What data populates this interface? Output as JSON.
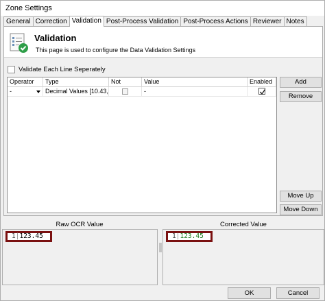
{
  "window": {
    "title": "Zone Settings"
  },
  "tabs": [
    {
      "label": "General"
    },
    {
      "label": "Correction"
    },
    {
      "label": "Validation"
    },
    {
      "label": "Post-Process Validation"
    },
    {
      "label": "Post-Process Actions"
    },
    {
      "label": "Reviewer"
    },
    {
      "label": "Notes"
    }
  ],
  "active_tab": "Validation",
  "header": {
    "title": "Validation",
    "subtitle": "This page is used to configure the Data Validation Settings",
    "icon": "document-check-icon"
  },
  "validate_each_line": {
    "label": "Validate Each Line Seperately",
    "checked": false
  },
  "grid": {
    "columns": [
      "Operator",
      "Type",
      "Not",
      "Value",
      "Enabled"
    ],
    "rows": [
      {
        "operator": "-",
        "type": "Decimal Values [10.43, ...",
        "not": false,
        "value": "-",
        "enabled": true
      }
    ]
  },
  "side_buttons": {
    "add": "Add",
    "remove": "Remove",
    "move_up": "Move Up",
    "move_down": "Move Down"
  },
  "raw_ocr": {
    "title": "Raw OCR Value",
    "line_no": "1",
    "value": "123.45"
  },
  "corrected": {
    "title": "Corrected Value",
    "line_no": "1",
    "value": "123.45"
  },
  "footer": {
    "ok": "OK",
    "cancel": "Cancel"
  }
}
